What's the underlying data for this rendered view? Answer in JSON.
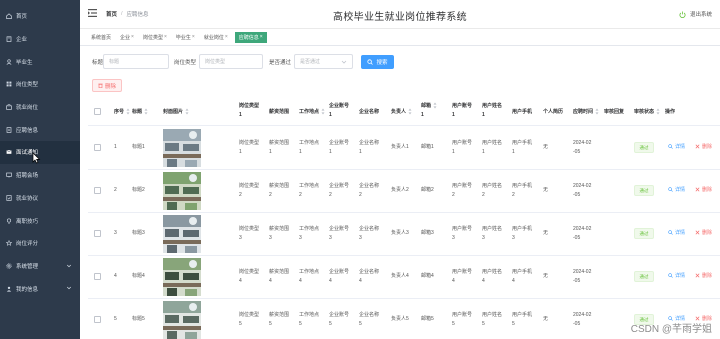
{
  "app_title": "高校毕业生就业岗位推荐系统",
  "logout_label": "退出系统",
  "breadcrumb": {
    "home": "首页",
    "separator": "/",
    "current": "应聘信息"
  },
  "sidebar": {
    "items": [
      {
        "label": "首页",
        "icon": "home-icon"
      },
      {
        "label": "企业",
        "icon": "building-icon"
      },
      {
        "label": "毕业生",
        "icon": "graduate-icon"
      },
      {
        "label": "岗位类型",
        "icon": "category-icon"
      },
      {
        "label": "就业岗位",
        "icon": "briefcase-icon"
      },
      {
        "label": "应聘信息",
        "icon": "document-icon"
      },
      {
        "label": "面试通知",
        "icon": "notice-icon",
        "active": true
      },
      {
        "label": "招聘会场",
        "icon": "venue-icon"
      },
      {
        "label": "就业协议",
        "icon": "agreement-icon"
      },
      {
        "label": "离职技巧",
        "icon": "tips-icon"
      },
      {
        "label": "岗位评分",
        "icon": "star-icon"
      },
      {
        "label": "系统管理",
        "icon": "settings-icon",
        "expandable": true
      },
      {
        "label": "我的信息",
        "icon": "user-icon",
        "expandable": true
      }
    ]
  },
  "tags": [
    {
      "label": "系统首页",
      "closable": false
    },
    {
      "label": "企业",
      "closable": true
    },
    {
      "label": "岗位类型",
      "closable": true
    },
    {
      "label": "毕业生",
      "closable": true
    },
    {
      "label": "就业岗位",
      "closable": true
    },
    {
      "label": "应聘信息",
      "closable": true,
      "active": true
    }
  ],
  "search": {
    "title_label": "标题",
    "title_placeholder": "标题",
    "type_label": "岗位类型",
    "type_placeholder": "岗位类型",
    "pass_label": "是否通过",
    "pass_placeholder": "是否通过",
    "search_button": "搜索"
  },
  "delete_button": "删除",
  "table": {
    "headers": [
      "序号",
      "标题",
      "封面图片",
      "岗位类型",
      "薪资范围",
      "工作地点",
      "企业账号",
      "企业名称",
      "负责人",
      "邮箱",
      "用户账号",
      "用户姓名",
      "用户手机",
      "个人简历",
      "应聘时间",
      "审核回复",
      "审核状态",
      "操作"
    ],
    "header_second_line": [
      "1",
      "1",
      "1",
      "1",
      "1"
    ],
    "rows": [
      {
        "index": "1",
        "title": "标题1",
        "type": [
          "岗位类型",
          "1"
        ],
        "salary": [
          "薪资范围",
          "1"
        ],
        "location": [
          "工作地点",
          "1"
        ],
        "company_account": [
          "企业账号",
          "1"
        ],
        "company_name": [
          "企业名称",
          "1"
        ],
        "manager": "负责人1",
        "email": "邮箱1",
        "user_account": [
          "用户账号",
          "1"
        ],
        "user_name": [
          "用户姓名",
          "1"
        ],
        "user_phone": [
          "用户手机",
          "1"
        ],
        "resume": "无",
        "time": [
          "2024-02",
          "-05"
        ],
        "status": "通过"
      },
      {
        "index": "2",
        "title": "标题2",
        "type": [
          "岗位类型",
          "2"
        ],
        "salary": [
          "薪资范围",
          "2"
        ],
        "location": [
          "工作地点",
          "2"
        ],
        "company_account": [
          "企业账号",
          "2"
        ],
        "company_name": [
          "企业名称",
          "2"
        ],
        "manager": "负责人2",
        "email": "邮箱2",
        "user_account": [
          "用户账号",
          "2"
        ],
        "user_name": [
          "用户姓名",
          "2"
        ],
        "user_phone": [
          "用户手机",
          "2"
        ],
        "resume": "无",
        "time": [
          "2024-02",
          "-05"
        ],
        "status": "通过"
      },
      {
        "index": "3",
        "title": "标题3",
        "type": [
          "岗位类型",
          "3"
        ],
        "salary": [
          "薪资范围",
          "3"
        ],
        "location": [
          "工作地点",
          "3"
        ],
        "company_account": [
          "企业账号",
          "3"
        ],
        "company_name": [
          "企业名称",
          "3"
        ],
        "manager": "负责人3",
        "email": "邮箱3",
        "user_account": [
          "用户账号",
          "3"
        ],
        "user_name": [
          "用户姓名",
          "3"
        ],
        "user_phone": [
          "用户手机",
          "3"
        ],
        "resume": "无",
        "time": [
          "2024-02",
          "-05"
        ],
        "status": "通过"
      },
      {
        "index": "4",
        "title": "标题4",
        "type": [
          "岗位类型",
          "4"
        ],
        "salary": [
          "薪资范围",
          "4"
        ],
        "location": [
          "工作地点",
          "4"
        ],
        "company_account": [
          "企业账号",
          "4"
        ],
        "company_name": [
          "企业名称",
          "4"
        ],
        "manager": "负责人4",
        "email": "邮箱4",
        "user_account": [
          "用户账号",
          "4"
        ],
        "user_name": [
          "用户姓名",
          "4"
        ],
        "user_phone": [
          "用户手机",
          "4"
        ],
        "resume": "无",
        "time": [
          "2024-02",
          "-05"
        ],
        "status": "通过"
      },
      {
        "index": "5",
        "title": "标题5",
        "type": [
          "岗位类型",
          "5"
        ],
        "salary": [
          "薪资范围",
          "5"
        ],
        "location": [
          "工作地点",
          "5"
        ],
        "company_account": [
          "企业账号",
          "5"
        ],
        "company_name": [
          "企业名称",
          "5"
        ],
        "manager": "负责人5",
        "email": "邮箱5",
        "user_account": [
          "用户账号",
          "5"
        ],
        "user_name": [
          "用户姓名",
          "5"
        ],
        "user_phone": [
          "用户手机",
          "5"
        ],
        "resume": "无",
        "time": [
          "2024-02",
          "-05"
        ],
        "status": "通过"
      }
    ],
    "detail_label": "详情",
    "delete_label": "删除"
  },
  "watermark": "CSDN @芊雨学姐",
  "colors": {
    "sidebar_bg": "#2d3a4b",
    "active_tag": "#3ea77b",
    "primary": "#409eff",
    "danger": "#f56c6c",
    "success": "#67c23a"
  }
}
